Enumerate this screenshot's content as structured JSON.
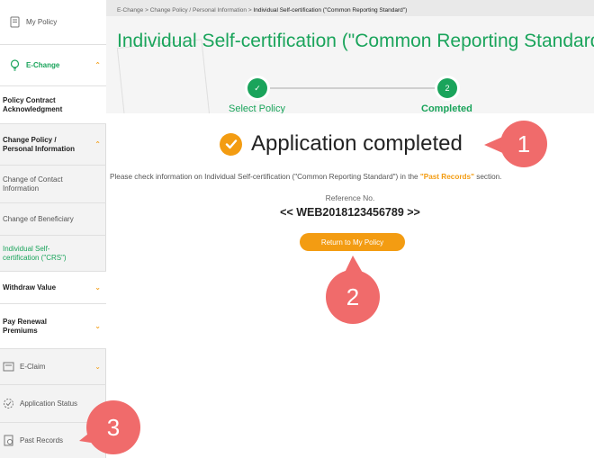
{
  "sidebar": {
    "items": [
      {
        "label": "My Policy",
        "icon": "document-icon"
      },
      {
        "label": "E-Change",
        "icon": "lightbulb-icon"
      },
      {
        "label": "Policy Contract Acknowledgment"
      },
      {
        "label": "Change Policy / Personal Information"
      },
      {
        "label": "Change of Contact Information"
      },
      {
        "label": "Change of Beneficiary"
      },
      {
        "label": "Individual Self-certification (\"CRS\")"
      },
      {
        "label": "Withdraw Value"
      },
      {
        "label": "Pay Renewal Premiums"
      },
      {
        "label": "E-Claim",
        "icon": "claim-icon"
      },
      {
        "label": "Application Status",
        "icon": "status-icon"
      },
      {
        "label": "Past Records",
        "icon": "records-icon"
      }
    ]
  },
  "breadcrumb": {
    "item1": "E-Change",
    "item2": "Change Policy / Personal Information",
    "current": "Individual Self-certification (\"Common Reporting Standard\")",
    "sep": ">"
  },
  "page": {
    "title": "Individual Self-certification (\"Common Reporting Standard\")"
  },
  "steps": [
    {
      "label": "Select Policy",
      "marker": "✓"
    },
    {
      "label": "Completed",
      "marker": "2"
    }
  ],
  "result": {
    "title": "Application completed",
    "info_before": "Please check information on Individual Self-certification (\"Common Reporting Standard\") in the ",
    "info_link": "\"Past Records\"",
    "info_after": " section.",
    "ref_label": "Reference No.",
    "ref_no": "<< WEB2018123456789 >>",
    "button": "Return to My Policy"
  },
  "callouts": [
    "1",
    "2",
    "3"
  ],
  "colors": {
    "accent_green": "#1aa45b",
    "accent_orange": "#f39c12",
    "callout_red": "#f06b6b"
  }
}
